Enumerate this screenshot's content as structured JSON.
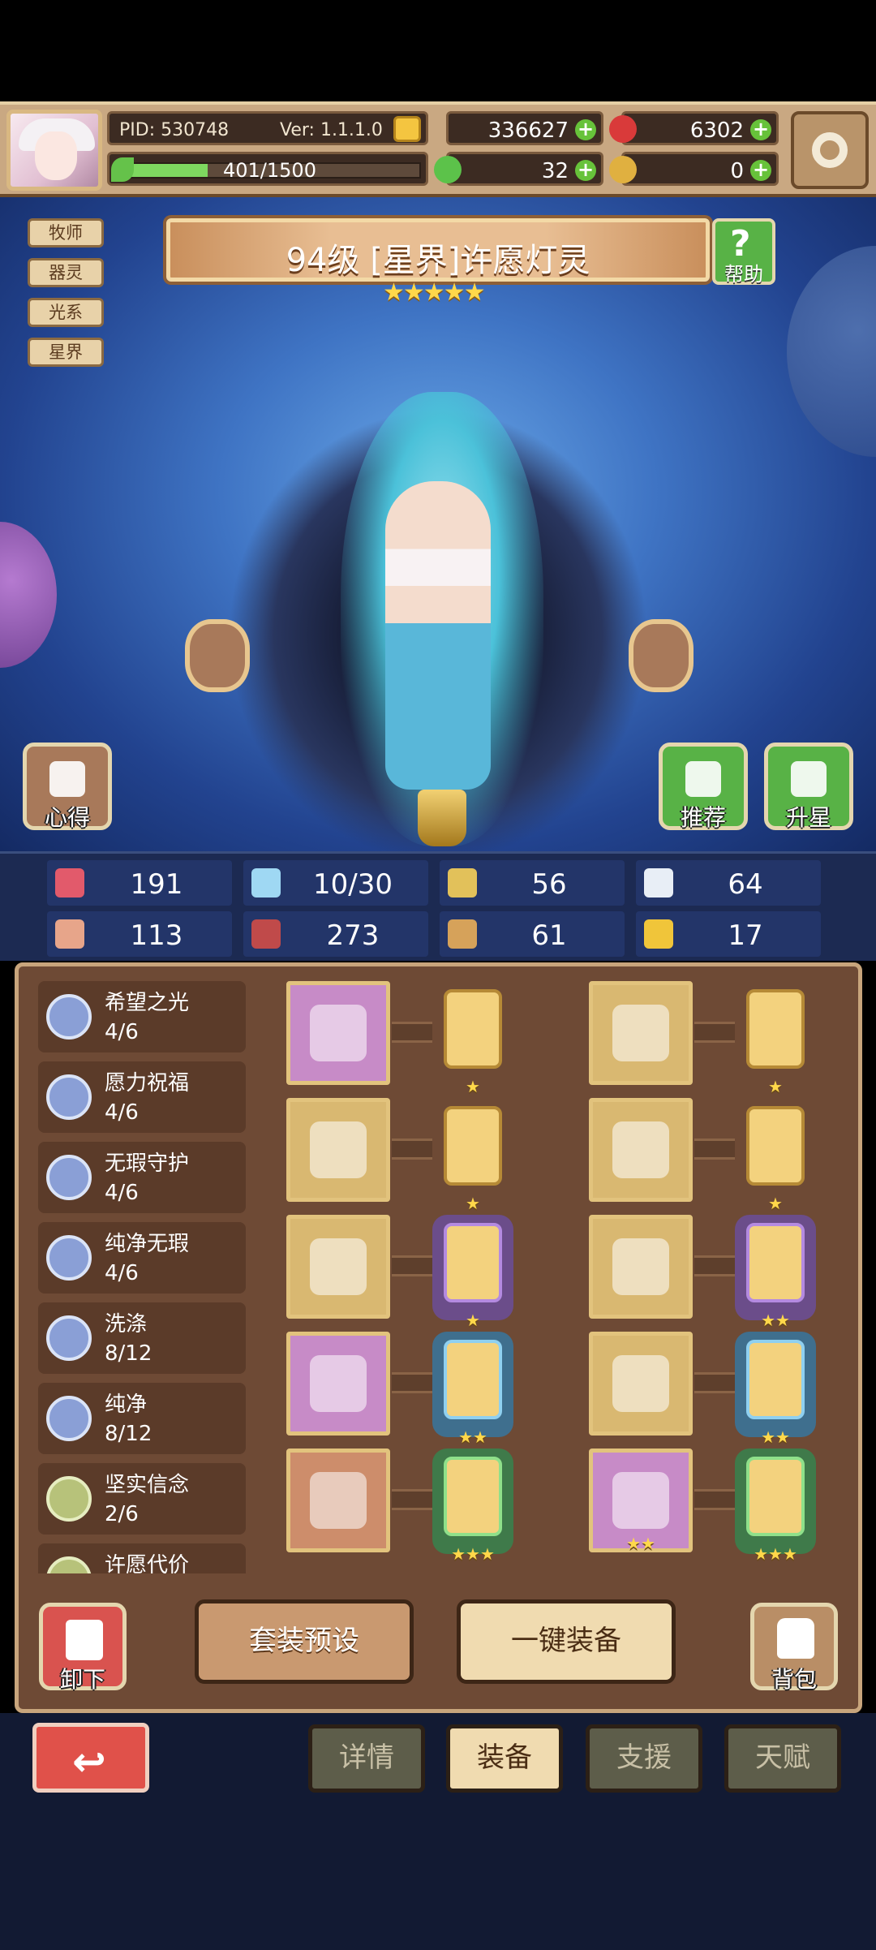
{
  "header": {
    "pid": "PID: 530748",
    "version": "Ver: 1.1.1.0",
    "exp_text": "401/1500",
    "exp_progress": 0.267,
    "gold": "336627",
    "gems": "6302",
    "clover": "32",
    "token": "0"
  },
  "hero": {
    "title": "94级  [星界]许愿灯灵",
    "stars": "★★★★★",
    "tags": [
      "牧师",
      "器灵",
      "光系",
      "星界"
    ],
    "help_label": "帮助",
    "left_button": "心得",
    "recommend_button": "推荐",
    "star_up_button": "升星"
  },
  "stats": [
    {
      "icon": "heart-icon",
      "value": "191",
      "color": "#e25a6b"
    },
    {
      "icon": "water-drop-icon",
      "value": "10/30",
      "color": "#9fd8f3"
    },
    {
      "icon": "shield-icon",
      "value": "56",
      "color": "#e2c15a"
    },
    {
      "icon": "wing-icon",
      "value": "64",
      "color": "#e8eef6"
    },
    {
      "icon": "fist-icon",
      "value": "113",
      "color": "#e7a58a"
    },
    {
      "icon": "book-icon",
      "value": "273",
      "color": "#c04a4a"
    },
    {
      "icon": "boot-icon",
      "value": "61",
      "color": "#d6a25a"
    },
    {
      "icon": "horseshoe-icon",
      "value": "17",
      "color": "#f0c53a"
    }
  ],
  "sets": [
    {
      "name": "希望之光",
      "count": "4/6"
    },
    {
      "name": "愿力祝福",
      "count": "4/6"
    },
    {
      "name": "无瑕守护",
      "count": "4/6"
    },
    {
      "name": "纯净无瑕",
      "count": "4/6"
    },
    {
      "name": "洗涤",
      "count": "8/12"
    },
    {
      "name": "纯净",
      "count": "8/12"
    },
    {
      "name": "坚实信念",
      "count": "2/6"
    },
    {
      "name": "许愿代价",
      "count": ""
    }
  ],
  "slots": [
    {
      "rarity": "purple",
      "stars": "",
      "card_stars": "★",
      "card_frame": "gold"
    },
    {
      "rarity": "gold",
      "stars": "",
      "card_stars": "★",
      "card_frame": "gold"
    },
    {
      "rarity": "gold",
      "stars": "",
      "card_stars": "★",
      "card_frame": "gold"
    },
    {
      "rarity": "gold",
      "stars": "",
      "card_stars": "★",
      "card_frame": "gold"
    },
    {
      "rarity": "gold",
      "stars": "",
      "card_stars": "★",
      "card_frame": "purple"
    },
    {
      "rarity": "gold",
      "stars": "",
      "card_stars": "★★",
      "card_frame": "purple"
    },
    {
      "rarity": "purple",
      "stars": "",
      "card_stars": "★★",
      "card_frame": "blue"
    },
    {
      "rarity": "gold",
      "stars": "",
      "card_stars": "★★",
      "card_frame": "blue"
    },
    {
      "rarity": "orange",
      "stars": "",
      "card_stars": "★★★",
      "card_frame": "green"
    },
    {
      "rarity": "purple",
      "stars": "★★",
      "card_stars": "★★★",
      "card_frame": "green"
    }
  ],
  "actions": {
    "unequip": "卸下",
    "preset": "套装预设",
    "equip_all": "一键装备",
    "bag": "背包"
  },
  "nav": {
    "details": "详情",
    "equip": "装备",
    "support": "支援",
    "talent": "天赋"
  },
  "colors": {
    "accent_gold": "#e2c37d",
    "panel_brown": "#6e4a35",
    "sky_blue": "#3f74c4"
  }
}
